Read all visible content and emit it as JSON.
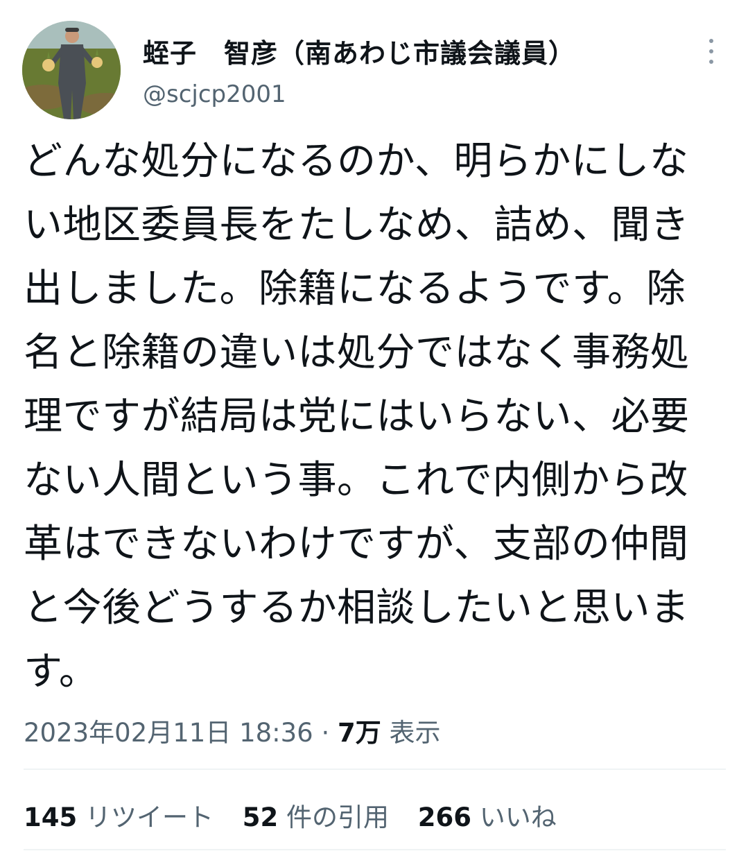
{
  "tweet": {
    "author": {
      "display_name": "蛭子　智彦（南あわじ市議会議員）",
      "handle": "@scjcp2001",
      "avatar_icon": "user-avatar-photo"
    },
    "more_icon": "more-options-icon",
    "text": "どんな処分になるのか、明らかにしない地区委員長をたしなめ、詰め、聞き出しました。除籍になるようです。除名と除籍の違いは処分ではなく事務処理ですが結局は党にはいらない、必要ない人間という事。これで内側から改革はできないわけですが、支部の仲間と今後どうするか相談したいと思います。",
    "timestamp": "2023年02月11日 18:36",
    "separator": " · ",
    "views_count": "7万",
    "views_label": " 表示",
    "stats": {
      "retweets": {
        "count": "145",
        "label": " リツイート"
      },
      "quotes": {
        "count": "52",
        "label": " 件の引用"
      },
      "likes": {
        "count": "266",
        "label": " いいね"
      }
    }
  }
}
